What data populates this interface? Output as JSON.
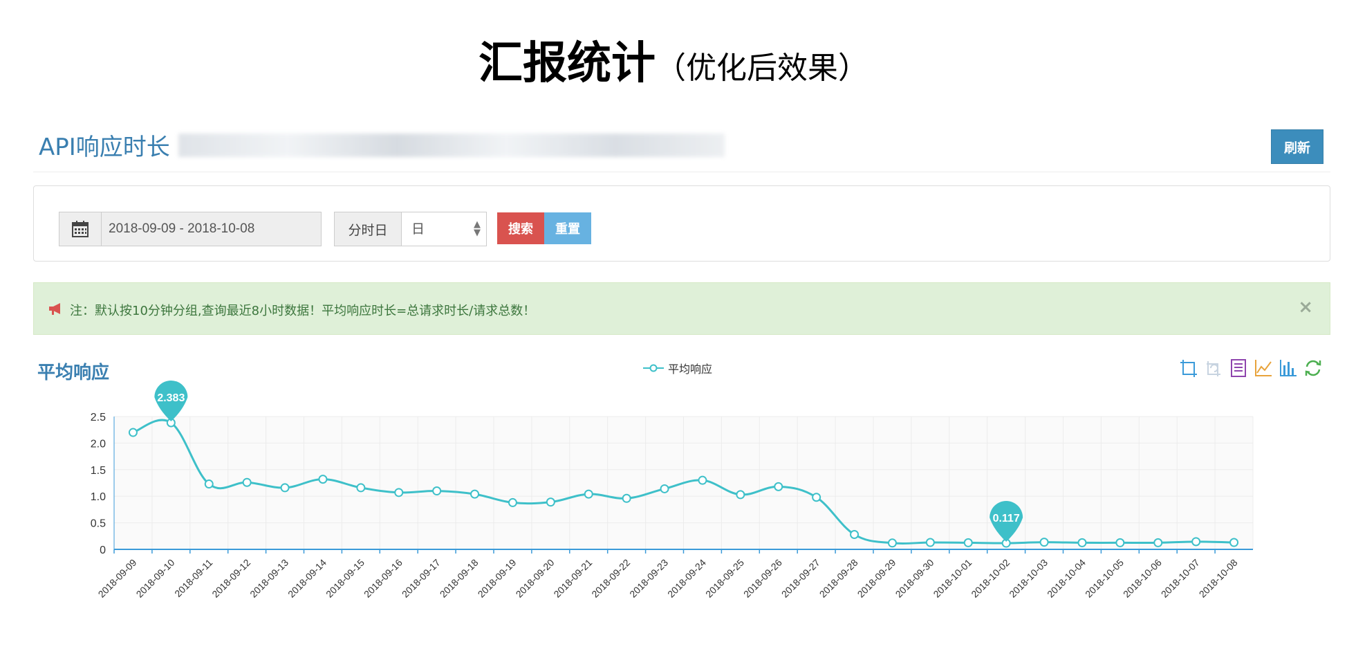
{
  "slide": {
    "title": "汇报统计",
    "subtitle": "（优化后效果）"
  },
  "header": {
    "title": "API响应时长",
    "refresh_label": "刷新"
  },
  "filter": {
    "date_range": "2018-09-09 - 2018-10-08",
    "group_label": "分时日",
    "group_value": "日",
    "search_label": "搜索",
    "reset_label": "重置"
  },
  "alert": {
    "message": "注：默认按10分钟分组,查询最近8小时数据！平均响应时长=总请求时长/请求总数！",
    "close": "×"
  },
  "chart_title": "平均响应",
  "icons": {
    "calendar": "calendar-icon",
    "bullhorn": "bullhorn-icon",
    "zoom": "data-zoom-icon",
    "zoom_reset": "zoom-reset-icon",
    "data_view": "data-view-icon",
    "line": "line-chart-icon",
    "bar": "bar-chart-icon",
    "restore": "restore-icon"
  },
  "colors": {
    "series": "#3ec0c9",
    "header_blue": "#3a7fb0",
    "refresh": "#3c8dbc",
    "search": "#d9534f",
    "reset": "#67b2e1",
    "alert_bg": "#dff0d8",
    "alert_text": "#3c763d"
  },
  "chart_data": {
    "type": "line",
    "title": "",
    "xlabel": "",
    "ylabel": "",
    "legend": "top-center",
    "grid": true,
    "ylim": [
      0,
      2.5
    ],
    "yticks": [
      "0",
      "0.5",
      "1.0",
      "1.5",
      "2.0",
      "2.5"
    ],
    "categories": [
      "2018-09-09",
      "2018-09-10",
      "2018-09-11",
      "2018-09-12",
      "2018-09-13",
      "2018-09-14",
      "2018-09-15",
      "2018-09-16",
      "2018-09-17",
      "2018-09-18",
      "2018-09-19",
      "2018-09-20",
      "2018-09-21",
      "2018-09-22",
      "2018-09-23",
      "2018-09-24",
      "2018-09-25",
      "2018-09-26",
      "2018-09-27",
      "2018-09-28",
      "2018-09-29",
      "2018-09-30",
      "2018-10-01",
      "2018-10-02",
      "2018-10-03",
      "2018-10-04",
      "2018-10-05",
      "2018-10-06",
      "2018-10-07",
      "2018-10-08"
    ],
    "series": [
      {
        "name": "平均响应",
        "values": [
          2.2,
          2.383,
          1.23,
          1.26,
          1.16,
          1.32,
          1.16,
          1.07,
          1.1,
          1.04,
          0.88,
          0.89,
          1.04,
          0.96,
          1.14,
          1.3,
          1.03,
          1.18,
          0.98,
          0.28,
          0.12,
          0.13,
          0.125,
          0.117,
          0.135,
          0.125,
          0.125,
          0.125,
          0.145,
          0.13
        ]
      }
    ],
    "markers": [
      {
        "label": "2.383",
        "index": 1
      },
      {
        "label": "0.117",
        "index": 23
      }
    ]
  }
}
